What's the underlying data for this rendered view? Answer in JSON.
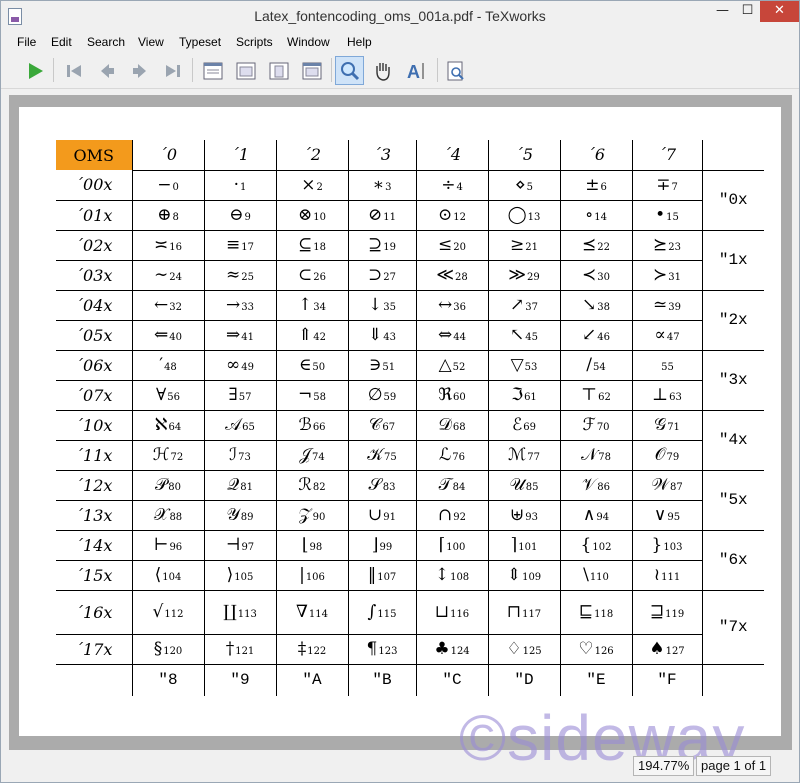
{
  "window": {
    "title": "Latex_fontencoding_oms_001a.pdf - TeXworks",
    "min": "—",
    "max": "☐",
    "close": "✕"
  },
  "menu": [
    "File",
    "Edit",
    "Search",
    "View",
    "Typeset",
    "Scripts",
    "Window",
    "Help"
  ],
  "status": {
    "zoom": "194.77%",
    "page": "page 1 of 1"
  },
  "watermark": "©sideway",
  "oms": {
    "corner": "OMS",
    "col_headers": [
      "´0",
      "´1",
      "´2",
      "´3",
      "´4",
      "´5",
      "´6",
      "´7"
    ],
    "rows": [
      {
        "label": "´00x",
        "group": "\"0x",
        "cells": [
          [
            "−",
            "0"
          ],
          [
            "·",
            "1"
          ],
          [
            "×",
            "2"
          ],
          [
            "∗",
            "3"
          ],
          [
            "÷",
            "4"
          ],
          [
            "⋄",
            "5"
          ],
          [
            "±",
            "6"
          ],
          [
            "∓",
            "7"
          ]
        ]
      },
      {
        "label": "´01x",
        "cells": [
          [
            "⊕",
            "8"
          ],
          [
            "⊖",
            "9"
          ],
          [
            "⊗",
            "10"
          ],
          [
            "⊘",
            "11"
          ],
          [
            "⊙",
            "12"
          ],
          [
            "◯",
            "13"
          ],
          [
            "∘",
            "14"
          ],
          [
            "•",
            "15"
          ]
        ]
      },
      {
        "label": "´02x",
        "group": "\"1x",
        "cells": [
          [
            "≍",
            "16"
          ],
          [
            "≡",
            "17"
          ],
          [
            "⊆",
            "18"
          ],
          [
            "⊇",
            "19"
          ],
          [
            "≤",
            "20"
          ],
          [
            "≥",
            "21"
          ],
          [
            "⪯",
            "22"
          ],
          [
            "⪰",
            "23"
          ]
        ]
      },
      {
        "label": "´03x",
        "cells": [
          [
            "∼",
            "24"
          ],
          [
            "≈",
            "25"
          ],
          [
            "⊂",
            "26"
          ],
          [
            "⊃",
            "27"
          ],
          [
            "≪",
            "28"
          ],
          [
            "≫",
            "29"
          ],
          [
            "≺",
            "30"
          ],
          [
            "≻",
            "31"
          ]
        ]
      },
      {
        "label": "´04x",
        "group": "\"2x",
        "cells": [
          [
            "←",
            "32"
          ],
          [
            "→",
            "33"
          ],
          [
            "↑",
            "34"
          ],
          [
            "↓",
            "35"
          ],
          [
            "↔",
            "36"
          ],
          [
            "↗",
            "37"
          ],
          [
            "↘",
            "38"
          ],
          [
            "≃",
            "39"
          ]
        ]
      },
      {
        "label": "´05x",
        "cells": [
          [
            "⇐",
            "40"
          ],
          [
            "⇒",
            "41"
          ],
          [
            "⇑",
            "42"
          ],
          [
            "⇓",
            "43"
          ],
          [
            "⇔",
            "44"
          ],
          [
            "↖",
            "45"
          ],
          [
            "↙",
            "46"
          ],
          [
            "∝",
            "47"
          ]
        ]
      },
      {
        "label": "´06x",
        "group": "\"3x",
        "cells": [
          [
            "′",
            "48"
          ],
          [
            "∞",
            "49"
          ],
          [
            "∈",
            "50"
          ],
          [
            "∋",
            "51"
          ],
          [
            "△",
            "52"
          ],
          [
            "▽",
            "53"
          ],
          [
            "/",
            "54"
          ],
          [
            "",
            "55"
          ]
        ]
      },
      {
        "label": "´07x",
        "cells": [
          [
            "∀",
            "56"
          ],
          [
            "∃",
            "57"
          ],
          [
            "¬",
            "58"
          ],
          [
            "∅",
            "59"
          ],
          [
            "ℜ",
            "60"
          ],
          [
            "ℑ",
            "61"
          ],
          [
            "⊤",
            "62"
          ],
          [
            "⊥",
            "63"
          ]
        ]
      },
      {
        "label": "´10x",
        "group": "\"4x",
        "cells": [
          [
            "ℵ",
            "64"
          ],
          [
            "𝒜",
            "65"
          ],
          [
            "ℬ",
            "66"
          ],
          [
            "𝒞",
            "67"
          ],
          [
            "𝒟",
            "68"
          ],
          [
            "ℰ",
            "69"
          ],
          [
            "ℱ",
            "70"
          ],
          [
            "𝒢",
            "71"
          ]
        ]
      },
      {
        "label": "´11x",
        "cells": [
          [
            "ℋ",
            "72"
          ],
          [
            "ℐ",
            "73"
          ],
          [
            "𝒥",
            "74"
          ],
          [
            "𝒦",
            "75"
          ],
          [
            "ℒ",
            "76"
          ],
          [
            "ℳ",
            "77"
          ],
          [
            "𝒩",
            "78"
          ],
          [
            "𝒪",
            "79"
          ]
        ]
      },
      {
        "label": "´12x",
        "group": "\"5x",
        "cells": [
          [
            "𝒫",
            "80"
          ],
          [
            "𝒬",
            "81"
          ],
          [
            "ℛ",
            "82"
          ],
          [
            "𝒮",
            "83"
          ],
          [
            "𝒯",
            "84"
          ],
          [
            "𝒰",
            "85"
          ],
          [
            "𝒱",
            "86"
          ],
          [
            "𝒲",
            "87"
          ]
        ]
      },
      {
        "label": "´13x",
        "cells": [
          [
            "𝒳",
            "88"
          ],
          [
            "𝒴",
            "89"
          ],
          [
            "𝒵",
            "90"
          ],
          [
            "∪",
            "91"
          ],
          [
            "∩",
            "92"
          ],
          [
            "⊎",
            "93"
          ],
          [
            "∧",
            "94"
          ],
          [
            "∨",
            "95"
          ]
        ]
      },
      {
        "label": "´14x",
        "group": "\"6x",
        "cells": [
          [
            "⊢",
            "96"
          ],
          [
            "⊣",
            "97"
          ],
          [
            "⌊",
            "98"
          ],
          [
            "⌋",
            "99"
          ],
          [
            "⌈",
            "100"
          ],
          [
            "⌉",
            "101"
          ],
          [
            "{",
            "102"
          ],
          [
            "}",
            "103"
          ]
        ]
      },
      {
        "label": "´15x",
        "cells": [
          [
            "⟨",
            "104"
          ],
          [
            "⟩",
            "105"
          ],
          [
            "|",
            "106"
          ],
          [
            "‖",
            "107"
          ],
          [
            "↕",
            "108"
          ],
          [
            "⇕",
            "109"
          ],
          [
            "\\",
            "110"
          ],
          [
            "≀",
            "111"
          ]
        ]
      },
      {
        "label": "´16x",
        "group": "\"7x",
        "cells": [
          [
            "√",
            "112"
          ],
          [
            "∐",
            "113"
          ],
          [
            "∇",
            "114"
          ],
          [
            "∫",
            "115"
          ],
          [
            "⊔",
            "116"
          ],
          [
            "⊓",
            "117"
          ],
          [
            "⊑",
            "118"
          ],
          [
            "⊒",
            "119"
          ]
        ]
      },
      {
        "label": "´17x",
        "cells": [
          [
            "§",
            "120"
          ],
          [
            "†",
            "121"
          ],
          [
            "‡",
            "122"
          ],
          [
            "¶",
            "123"
          ],
          [
            "♣",
            "124"
          ],
          [
            "♢",
            "125"
          ],
          [
            "♡",
            "126"
          ],
          [
            "♠",
            "127"
          ]
        ]
      }
    ],
    "bottom_headers": [
      "\"8",
      "\"9",
      "\"A",
      "\"B",
      "\"C",
      "\"D",
      "\"E",
      "\"F"
    ]
  }
}
